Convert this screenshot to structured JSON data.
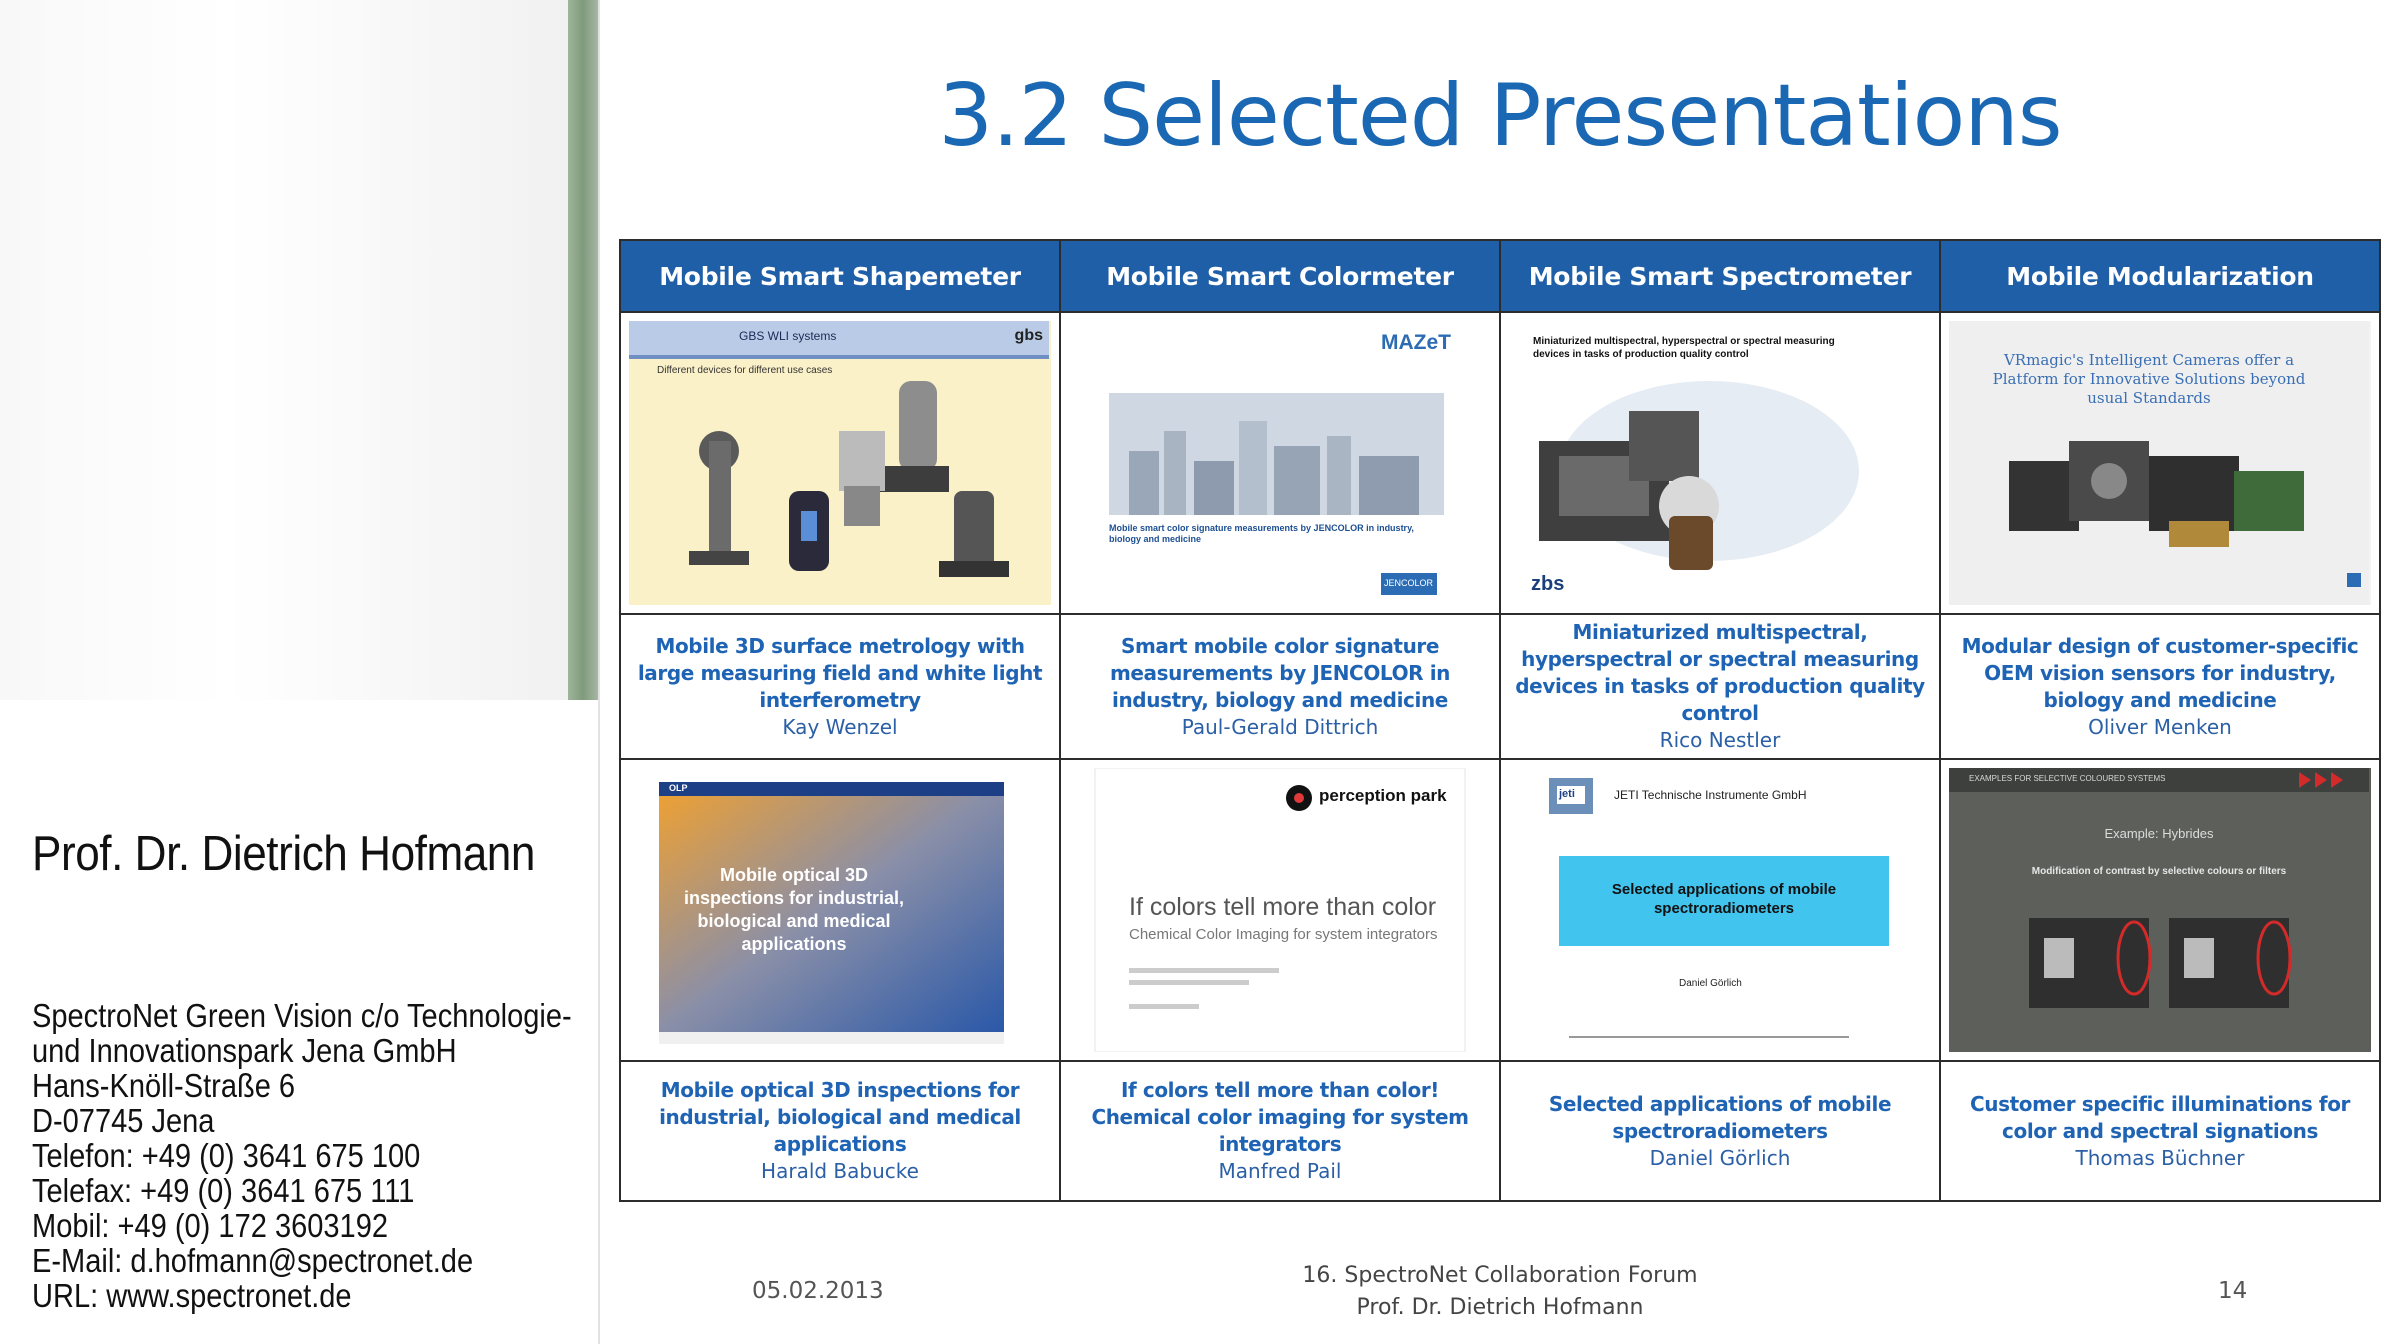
{
  "speaker": {
    "name": "Prof. Dr. Dietrich Hofmann",
    "contact_lines": [
      "SpectroNet Green Vision c/o Technologie-",
      "und Innovationspark Jena GmbH",
      "Hans-Knöll-Straße 6",
      "D-07745 Jena",
      "Telefon: +49 (0) 3641 675 100",
      "Telefax: +49 (0) 3641 675 111",
      "Mobil: +49 (0) 172 3603192",
      "E-Mail: d.hofmann@spectronet.de",
      "URL: www.spectronet.de"
    ]
  },
  "slide": {
    "title": "3.2 Selected Presentations",
    "columns": [
      "Mobile Smart Shapemeter",
      "Mobile Smart Colormeter",
      "Mobile Smart Spectrometer",
      "Mobile Modularization"
    ],
    "row1": [
      {
        "title": "Mobile 3D surface metrology with large measuring field and white light interferometry",
        "author": "Kay Wenzel"
      },
      {
        "title": "Smart mobile color signature measurements by JENCOLOR in industry, biology and medicine",
        "author": "Paul-Gerald Dittrich"
      },
      {
        "title": "Miniaturized multispectral, hyperspectral or spectral measuring devices in tasks of production quality control",
        "author": "Rico Nestler"
      },
      {
        "title": "Modular design of customer-specific OEM vision sensors for industry, biology and medicine",
        "author": "Oliver Menken"
      }
    ],
    "row2": [
      {
        "title": "Mobile optical 3D inspections for industrial, biological and medical applications",
        "author": "Harald Babucke"
      },
      {
        "title": "If colors tell more than color! Chemical color imaging for system integrators",
        "author": "Manfred Pail"
      },
      {
        "title": "Selected applications of mobile spectroradiometers",
        "author": "Daniel Görlich"
      },
      {
        "title": "Customer specific illuminations for color and spectral signations",
        "author": "Thomas Büchner"
      }
    ],
    "thumbs": {
      "gbs_header": "GBS WLI systems",
      "gbs_sub": "Different devices for different use cases",
      "gbs_logo": "gbs",
      "mazet_logo": "MAZeT",
      "mazet_title": "Mobile smart color signature measurements by JENCOLOR in industry, biology and medicine",
      "mazet_brand": "JENCOLOR",
      "zbs_title": "Miniaturized multispectral, hyperspectral or spectral measuring devices in tasks of production quality control",
      "zbs_logo": "zbs",
      "vr_title": "VRmagic's Intelligent Cameras offer a Platform for Innovative Solutions beyond usual Standards",
      "olp_title": "Mobile optical 3D inspections for industrial, biological and medical applications",
      "olp_logo": "OLP",
      "pp_logo": "perception park",
      "pp_title": "If colors tell more than color",
      "pp_sub": "Chemical Color Imaging for system integrators",
      "jeti_logo": "jeti",
      "jeti_company": "JETI Technische Instrumente GmbH",
      "jeti_box": "Selected applications of mobile spectroradiometers",
      "jeti_author": "Daniel Görlich",
      "hyb_header": "EXAMPLES FOR SELECTIVE COLOURED SYSTEMS",
      "hyb_title": "Example: Hybrides",
      "hyb_sub": "Modification of contrast by selective colours or filters"
    },
    "footer": {
      "date": "05.02.2013",
      "event": "16. SpectroNet Collaboration Forum",
      "presenter": "Prof. Dr. Dietrich Hofmann",
      "page": "14"
    }
  },
  "colors": {
    "title_blue": "#1a68b3",
    "header_blue": "#1f5fa8",
    "caption_blue": "#1f64b4"
  }
}
